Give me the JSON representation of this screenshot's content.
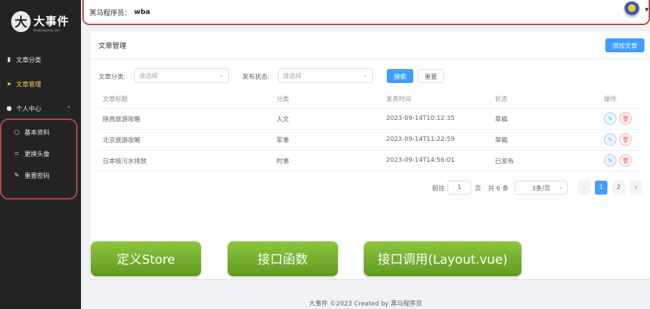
{
  "sidebar": {
    "logo_mark": "大",
    "logo_title": "大事件",
    "logo_sub": "Breakingnews.com",
    "items": [
      {
        "label": "文章分类",
        "icon": "folder-icon"
      },
      {
        "label": "文章管理",
        "icon": "send-icon",
        "active": true
      },
      {
        "label": "个人中心",
        "icon": "user-icon"
      }
    ],
    "subitems": [
      {
        "label": "基本资料",
        "icon": "user-outline-icon"
      },
      {
        "label": "更换头像",
        "icon": "crop-icon"
      },
      {
        "label": "重置密码",
        "icon": "edit-pen-icon"
      }
    ]
  },
  "header": {
    "label": "黑马程序员：",
    "username": "wba"
  },
  "card": {
    "title": "文章管理",
    "add_button": "添加文章",
    "filters": {
      "category_label": "文章分类:",
      "category_placeholder": "请选择",
      "status_label": "发布状态:",
      "status_placeholder": "请选择",
      "search_button": "搜索",
      "reset_button": "重置"
    },
    "table": {
      "headers": [
        "文章标题",
        "分类",
        "发表时间",
        "状态",
        "操作"
      ],
      "rows": [
        {
          "title": "陕西旅游攻略",
          "category": "人文",
          "time": "2023-09-14T10:12:35",
          "status": "草稿"
        },
        {
          "title": "北京旅游攻略",
          "category": "军事",
          "time": "2023-09-14T11:22:59",
          "status": "草稿"
        },
        {
          "title": "日本核污水排放",
          "category": "时事",
          "time": "2023-09-14T14:56:01",
          "status": "已发布"
        }
      ]
    },
    "pagination": {
      "goto_prefix": "前往",
      "goto_value": "1",
      "goto_suffix": "页",
      "total": "共 6 条",
      "page_size": "3条/页",
      "prev": "‹",
      "pages": [
        "1",
        "2"
      ],
      "next": "›"
    }
  },
  "overlay_buttons": [
    "定义Store",
    "接口函数",
    "接口调用(Layout.vue)"
  ],
  "footer": "大事件 ©2023 Created by 黑马程序员",
  "colors": {
    "sidebar_bg": "#232323",
    "active": "#ffd04b",
    "primary": "#409eff",
    "highlight_border": "#b7474a",
    "green": "#7cb342"
  }
}
